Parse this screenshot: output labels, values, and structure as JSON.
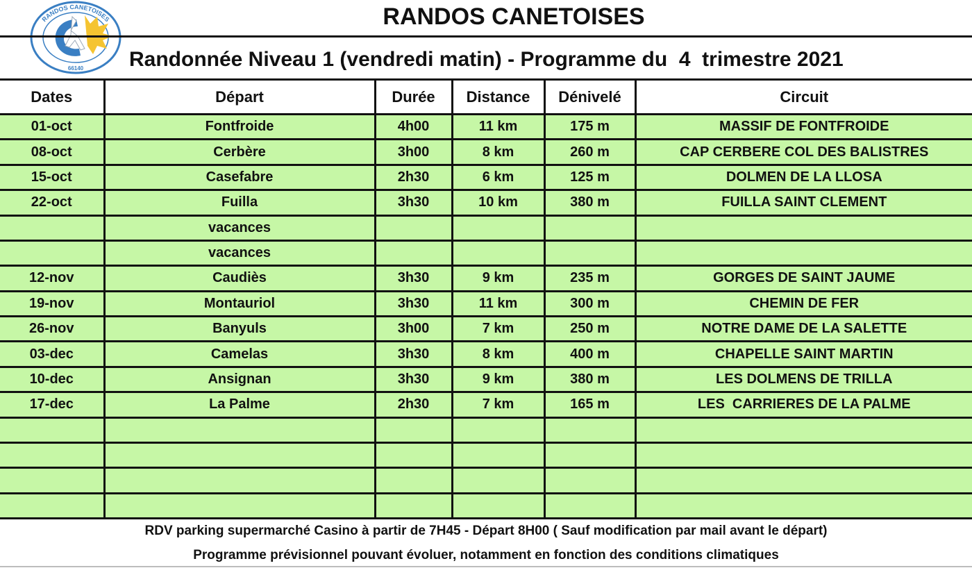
{
  "header": {
    "logo_text_top": "RANDOS CANETOISES",
    "logo_text_bottom": "66140",
    "title": "RANDOS CANETOISES",
    "subtitle": "Randonnée Niveau 1 (vendredi matin) - Programme du  4  trimestre 2021"
  },
  "colors": {
    "row_background": "#c6f7a6",
    "rule": "#111111",
    "logo_blue": "#3a7fc3",
    "logo_yellow": "#f5c431"
  },
  "table": {
    "columns": [
      "Dates",
      "Départ",
      "Durée",
      "Distance",
      "Dénivelé",
      "Circuit"
    ],
    "rows": [
      {
        "date": "01-oct",
        "depart": "Fontfroide",
        "duree": "4h00",
        "distance": "11 km",
        "denivele": "175 m",
        "circuit": "MASSIF DE FONTFROIDE"
      },
      {
        "date": "08-oct",
        "depart": "Cerbère",
        "duree": "3h00",
        "distance": "8 km",
        "denivele": "260 m",
        "circuit": "CAP CERBERE COL DES BALISTRES"
      },
      {
        "date": "15-oct",
        "depart": "Casefabre",
        "duree": "2h30",
        "distance": "6 km",
        "denivele": "125 m",
        "circuit": "DOLMEN DE LA LLOSA"
      },
      {
        "date": "22-oct",
        "depart": "Fuilla",
        "duree": "3h30",
        "distance": "10 km",
        "denivele": "380 m",
        "circuit": "FUILLA SAINT CLEMENT"
      },
      {
        "date": "",
        "depart": "vacances",
        "duree": "",
        "distance": "",
        "denivele": "",
        "circuit": ""
      },
      {
        "date": "",
        "depart": "vacances",
        "duree": "",
        "distance": "",
        "denivele": "",
        "circuit": ""
      },
      {
        "date": "12-nov",
        "depart": "Caudiès",
        "duree": "3h30",
        "distance": "9 km",
        "denivele": "235 m",
        "circuit": "GORGES DE SAINT JAUME"
      },
      {
        "date": "19-nov",
        "depart": "Montauriol",
        "duree": "3h30",
        "distance": "11 km",
        "denivele": "300 m",
        "circuit": "CHEMIN DE FER"
      },
      {
        "date": "26-nov",
        "depart": "Banyuls",
        "duree": "3h00",
        "distance": "7 km",
        "denivele": "250 m",
        "circuit": "NOTRE DAME DE LA SALETTE"
      },
      {
        "date": "03-dec",
        "depart": "Camelas",
        "duree": "3h30",
        "distance": "8 km",
        "denivele": "400 m",
        "circuit": "CHAPELLE SAINT MARTIN"
      },
      {
        "date": "10-dec",
        "depart": "Ansignan",
        "duree": "3h30",
        "distance": "9 km",
        "denivele": "380 m",
        "circuit": "LES DOLMENS DE TRILLA"
      },
      {
        "date": "17-dec",
        "depart": "La Palme",
        "duree": "2h30",
        "distance": "7 km",
        "denivele": "165 m",
        "circuit": "LES  CARRIERES DE LA PALME"
      },
      {
        "date": "",
        "depart": "",
        "duree": "",
        "distance": "",
        "denivele": "",
        "circuit": ""
      },
      {
        "date": "",
        "depart": "",
        "duree": "",
        "distance": "",
        "denivele": "",
        "circuit": ""
      },
      {
        "date": "",
        "depart": "",
        "duree": "",
        "distance": "",
        "denivele": "",
        "circuit": ""
      },
      {
        "date": "",
        "depart": "",
        "duree": "",
        "distance": "",
        "denivele": "",
        "circuit": ""
      }
    ]
  },
  "footer": {
    "line1": "RDV parking supermarché Casino à partir de 7H45 - Départ 8H00 ( Sauf modification par mail avant le départ)",
    "line2": "Programme prévisionnel pouvant évoluer, notamment en fonction des conditions climatiques"
  }
}
